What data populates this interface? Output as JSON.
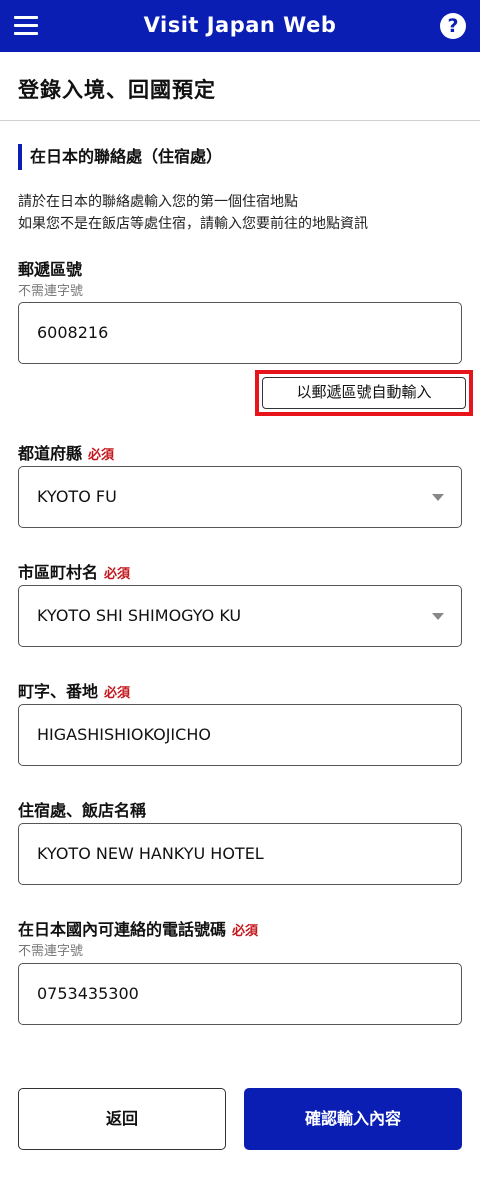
{
  "header": {
    "title": "Visit Japan Web",
    "menu_icon": "hamburger-menu-icon",
    "help_icon_glyph": "?",
    "brand_color": "#0a1eb3"
  },
  "page": {
    "title": "登錄入境、回國預定"
  },
  "section": {
    "heading": "在日本的聯絡處（住宿處）",
    "description_line1": "請於在日本的聯絡處輸入您的第一個住宿地點",
    "description_line2": "如果您不是在飯店等處住宿，請輸入您要前往的地點資訊"
  },
  "form": {
    "postal_code": {
      "label": "郵遞區號",
      "hint": "不需連字號",
      "value": "6008216",
      "autofill_button": "以郵遞區號自動輸入"
    },
    "prefecture": {
      "label": "都道府縣",
      "required": "必須",
      "value": "KYOTO FU"
    },
    "city": {
      "label": "市區町村名",
      "required": "必須",
      "value": "KYOTO SHI SHIMOGYO KU"
    },
    "street": {
      "label": "町字、番地",
      "required": "必須",
      "value": "HIGASHISHIOKOJICHO"
    },
    "hotel": {
      "label": "住宿處、飯店名稱",
      "value": "KYOTO NEW HANKYU HOTEL"
    },
    "phone": {
      "label": "在日本國內可連絡的電話號碼",
      "required": "必須",
      "hint": "不需連字號",
      "value": "0753435300"
    }
  },
  "actions": {
    "back_label": "返回",
    "confirm_label": "確認輸入內容"
  },
  "colors": {
    "required": "#c4161c",
    "highlight": "#e8141c"
  }
}
